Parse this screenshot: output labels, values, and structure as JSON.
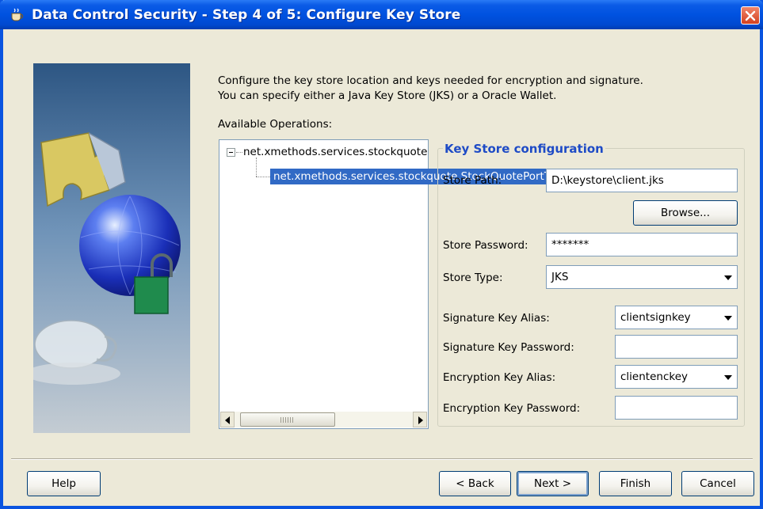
{
  "window": {
    "title": "Data Control Security - Step 4 of 5: Configure Key Store",
    "description_line1": "Configure the key store location and keys needed for encryption and signature.",
    "description_line2": "You can specify either a Java Key Store (JKS) or a Oracle Wallet."
  },
  "operations": {
    "label": "Available Operations:",
    "tree": [
      {
        "text": "net.xmethods.services.stockquote",
        "level": 0,
        "expanded": true,
        "selected": false
      },
      {
        "text": "net.xmethods.services.stockquote.StockQuotePortType",
        "level": 1,
        "selected": true
      }
    ]
  },
  "keystore": {
    "group_title": "Key Store configuration",
    "store_path_label": "Store Path:",
    "store_path_value": "D:\\keystore\\client.jks",
    "browse_label": "Browse...",
    "store_password_label": "Store Password:",
    "store_password_value": "*******",
    "store_type_label": "Store Type:",
    "store_type_value": "JKS",
    "sig_alias_label": "Signature Key Alias:",
    "sig_alias_value": "clientsignkey",
    "sig_password_label": "Signature Key Password:",
    "sig_password_value": "",
    "enc_alias_label": "Encryption Key Alias:",
    "enc_alias_value": "clientenckey",
    "enc_password_label": "Encryption Key Password:",
    "enc_password_value": ""
  },
  "buttons": {
    "help": "Help",
    "back": "< Back",
    "next": "Next >",
    "finish": "Finish",
    "cancel": "Cancel"
  },
  "colors": {
    "titlebar": "#0052e0",
    "selection": "#316ac5",
    "group_title": "#1e4bc6",
    "dialog_bg": "#ece9d8"
  }
}
